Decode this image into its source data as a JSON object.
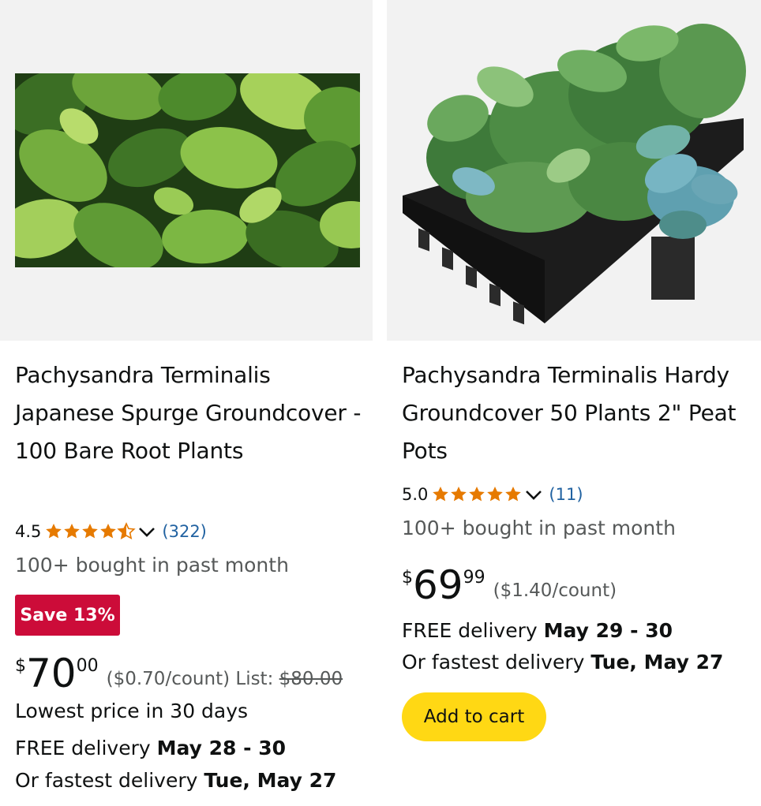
{
  "products": [
    {
      "title": "Pachysandra Terminalis Japanese Spurge Groundcover - 100 Bare Root Plants",
      "image": "pachysandra-leaves-closeup-photo",
      "rating": "4.5",
      "rating_value": 4.5,
      "review_count": "(322)",
      "bought": "100+ bought in past month",
      "badge": "Save 13%",
      "price_symbol": "$",
      "price_whole": "70",
      "price_fraction": "00",
      "unit_price": "($0.70/count)",
      "list_label": "List:",
      "list_price": "$80.00",
      "lowest_price": "Lowest price in 30 days",
      "delivery_prefix": "FREE delivery",
      "delivery_dates": "May 28 - 30",
      "fastest_prefix": "Or fastest delivery",
      "fastest_date": "Tue, May 27"
    },
    {
      "title": "Pachysandra Terminalis Hardy Groundcover 50 Plants 2\" Peat Pots",
      "image": "pachysandra-plants-in-black-tray-photo",
      "rating": "5.0",
      "rating_value": 5.0,
      "review_count": "(11)",
      "bought": "100+ bought in past month",
      "price_symbol": "$",
      "price_whole": "69",
      "price_fraction": "99",
      "unit_price": "($1.40/count)",
      "delivery_prefix": "FREE delivery",
      "delivery_dates": "May 29 - 30",
      "fastest_prefix": "Or fastest delivery",
      "fastest_date": "Tue, May 27",
      "cart_label": "Add to cart"
    }
  ],
  "colors": {
    "star": "#e67a00",
    "badge": "#cc0c39",
    "cart_button": "#ffd814",
    "link": "#2162a1",
    "muted_text": "#565959"
  }
}
